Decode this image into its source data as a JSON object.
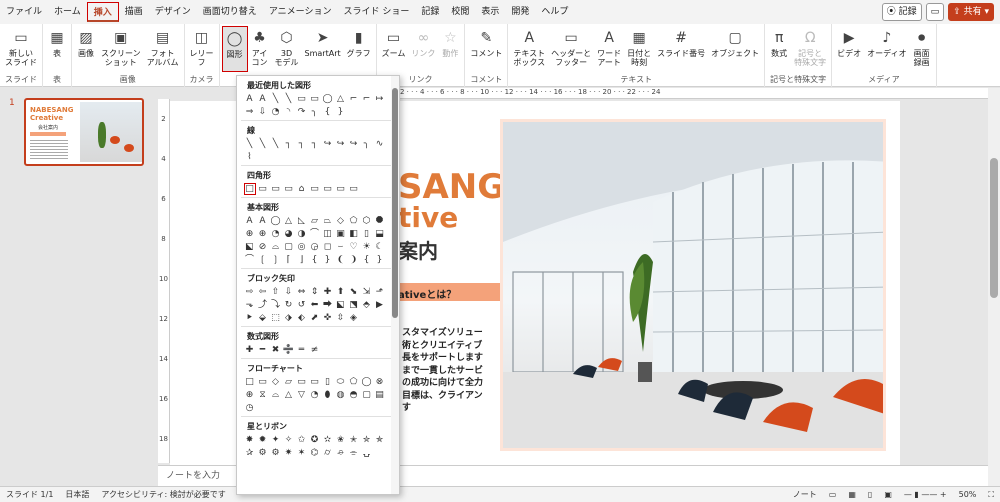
{
  "tabs": [
    "ファイル",
    "ホーム",
    "挿入",
    "描画",
    "デザイン",
    "画面切り替え",
    "アニメーション",
    "スライド ショー",
    "記録",
    "校閲",
    "表示",
    "開発",
    "ヘルプ"
  ],
  "tab_active_index": 2,
  "right_buttons": {
    "record": "記録",
    "share": "共有"
  },
  "ribbon": {
    "groups": [
      {
        "label": "スライド",
        "buttons": [
          {
            "label": "新しい\nスライド",
            "icon": "▭"
          }
        ]
      },
      {
        "label": "表",
        "buttons": [
          {
            "label": "表",
            "icon": "▦"
          }
        ]
      },
      {
        "label": "画像",
        "buttons": [
          {
            "label": "画像",
            "icon": "▨"
          },
          {
            "label": "スクリーン\nショット",
            "icon": "▣"
          },
          {
            "label": "フォト\nアルバム",
            "icon": "▤"
          }
        ]
      },
      {
        "label": "カメラ",
        "buttons": [
          {
            "label": "レリー\nフ",
            "icon": "◫"
          }
        ]
      },
      {
        "label": "",
        "buttons": [
          {
            "label": "図形",
            "icon": "◯"
          },
          {
            "label": "アイ\nコン",
            "icon": "♣"
          },
          {
            "label": "3D\nモデル",
            "icon": "⬡"
          },
          {
            "label": "SmartArt",
            "icon": "➤"
          },
          {
            "label": "グラフ",
            "icon": "▮"
          }
        ]
      },
      {
        "label": "リンク",
        "buttons": [
          {
            "label": "ズーム",
            "icon": "▭"
          },
          {
            "label": "リンク",
            "icon": "∞"
          },
          {
            "label": "動作",
            "icon": "☆"
          }
        ]
      },
      {
        "label": "コメント",
        "buttons": [
          {
            "label": "コメント",
            "icon": "✎"
          }
        ]
      },
      {
        "label": "テキスト",
        "buttons": [
          {
            "label": "テキスト\nボックス",
            "icon": "A"
          },
          {
            "label": "ヘッダーと\nフッター",
            "icon": "▭"
          },
          {
            "label": "ワード\nアート",
            "icon": "A"
          },
          {
            "label": "日付と\n時刻",
            "icon": "▦"
          },
          {
            "label": "スライド番号",
            "icon": "#"
          },
          {
            "label": "オブジェクト",
            "icon": "▢"
          }
        ]
      },
      {
        "label": "記号と特殊文字",
        "buttons": [
          {
            "label": "数式",
            "icon": "π"
          },
          {
            "label": "記号と\n特殊文字",
            "icon": "Ω"
          }
        ]
      },
      {
        "label": "メディア",
        "buttons": [
          {
            "label": "ビデオ",
            "icon": "▶"
          },
          {
            "label": "オーディオ",
            "icon": "♪"
          },
          {
            "label": "画面\n録画",
            "icon": "⏺"
          }
        ]
      }
    ]
  },
  "slide_number": "1",
  "thumbnail": {
    "title": "NABESANG\nCreative",
    "subtitle": "会社案内"
  },
  "slide": {
    "title_line1": "SANG",
    "title_line2": "tive",
    "title_line3": "案内",
    "banner": "ativeとは？",
    "body": "スタマイズソリュー\n術とクリエイティブ\n長をサポートします\nまで一貫したサービ\nの成功に向けて全力\n目標は、クライアン\nす"
  },
  "ruler_top": "2 · · · 4 · · · 6 · · · 8 · · · 10 · · · 12 · · · 14 · · · 16 · · · 18 · · · 20 · · · 22 · · · 24",
  "ruler_left": [
    "2",
    "4",
    "6",
    "8",
    "10",
    "12",
    "14",
    "16",
    "18"
  ],
  "notes_placeholder": "ノートを入力",
  "status": {
    "slide": "スライド 1/1",
    "language": "日本語",
    "accessibility": "アクセシビリティ: 検討が必要です",
    "notes": "ノート",
    "zoom": "50%"
  },
  "shapes_menu": {
    "sections": [
      {
        "title": "最近使用した図形",
        "glyphs": [
          "A",
          "A",
          "╲",
          "╲",
          "▭",
          "▭",
          "◯",
          "△",
          "⌐",
          "⌐",
          "↦",
          "⇒",
          "⇩",
          "◔",
          "◝",
          "↷",
          "╮",
          "{",
          "}"
        ]
      },
      {
        "title": "線",
        "glyphs": [
          "╲",
          "╲",
          "╲",
          "┐",
          "┐",
          "┐",
          "↪",
          "↪",
          "↪",
          "╮",
          "∿",
          "⌇"
        ]
      },
      {
        "title": "四角形",
        "glyphs": [
          "□",
          "▭",
          "▭",
          "▭",
          "⌂",
          "▭",
          "▭",
          "▭",
          "▭"
        ]
      },
      {
        "title": "基本図形",
        "glyphs": [
          "A",
          "A",
          "◯",
          "△",
          "◺",
          "▱",
          "⏢",
          "◇",
          "⬠",
          "⬡",
          "⯃",
          "⊕",
          "⊕",
          "◔",
          "◕",
          "◑",
          "⌒",
          "◫",
          "▣",
          "◧",
          "▯",
          "⬓",
          "⬕",
          "⊘",
          "⌓",
          "▢",
          "◎",
          "◶",
          "◻",
          "⌣",
          "♡",
          "☀",
          "☾",
          "⌒",
          "❲",
          "❳",
          "⌈",
          "⌋",
          "{",
          "}",
          "❨",
          "❩",
          "{",
          "}"
        ]
      },
      {
        "title": "ブロック矢印",
        "glyphs": [
          "⇨",
          "⇦",
          "⇧",
          "⇩",
          "⇔",
          "⇕",
          "✚",
          "⬆",
          "⬊",
          "⇲",
          "⬏",
          "⬎",
          "⤴",
          "⤵",
          "↻",
          "↺",
          "⬅",
          "⮕",
          "⬕",
          "⬔",
          "⬘",
          "▶",
          "⯈",
          "⬙",
          "⬚",
          "⬗",
          "⬖",
          "⬈",
          "✜",
          "⇳",
          "◈"
        ]
      },
      {
        "title": "数式図形",
        "glyphs": [
          "✚",
          "━",
          "✖",
          "➗",
          "═",
          "≠"
        ]
      },
      {
        "title": "フローチャート",
        "glyphs": [
          "□",
          "▭",
          "◇",
          "▱",
          "▭",
          "▭",
          "▯",
          "⬭",
          "⬠",
          "◯",
          "⊗",
          "⊕",
          "⧖",
          "⌓",
          "△",
          "▽",
          "◔",
          "⬮",
          "◍",
          "◓",
          "▢",
          "▤",
          "◷"
        ]
      },
      {
        "title": "星とリボン",
        "glyphs": [
          "✸",
          "✹",
          "✦",
          "✧",
          "✩",
          "✪",
          "✫",
          "✬",
          "✭",
          "✮",
          "✯",
          "✰",
          "⚙",
          "⚙",
          "✷",
          "✶",
          "⌬",
          "⌭",
          "⌮",
          "⌯",
          "⍽"
        ]
      }
    ],
    "selected_section": 2,
    "selected_index": 0
  }
}
